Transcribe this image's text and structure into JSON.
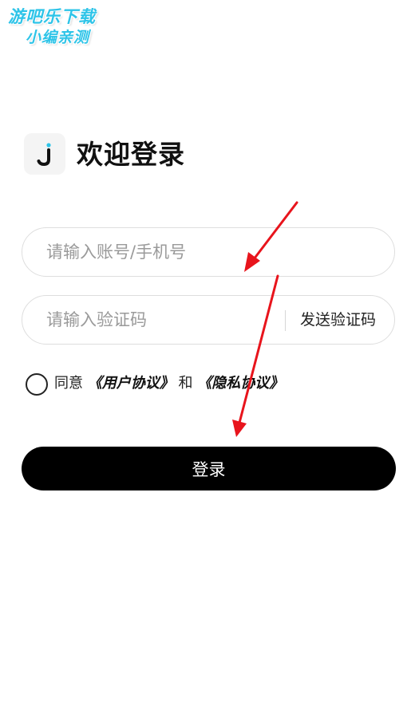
{
  "watermark": {
    "line1": "游吧乐下载",
    "line2": "小编亲测"
  },
  "header": {
    "title": "欢迎登录",
    "logo_icon": "app-logo-j-icon"
  },
  "form": {
    "account_placeholder": "请输入账号/手机号",
    "code_placeholder": "请输入验证码",
    "send_code_label": "发送验证码"
  },
  "agreement": {
    "agree": "同意",
    "user_agreement": "《用户协议》",
    "and": "和",
    "privacy_policy": "《隐私协议》"
  },
  "login_button": "登录",
  "colors": {
    "primary": "#000000",
    "annotation_arrow": "#e8141c",
    "logo_accent": "#2ec4e8",
    "watermark": "#2ec4e8"
  }
}
